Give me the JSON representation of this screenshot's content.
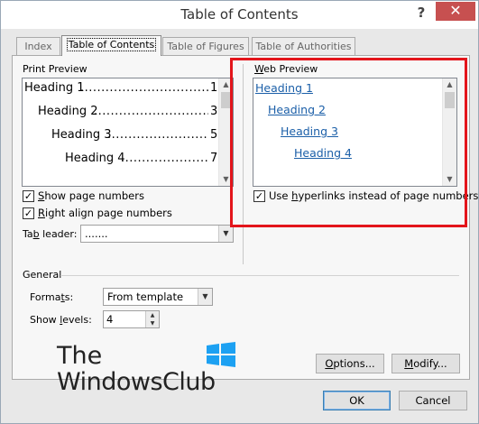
{
  "window": {
    "title": "Table of Contents",
    "help_glyph": "?",
    "close_glyph": "✕"
  },
  "tabs": [
    {
      "label": "Index",
      "active": false
    },
    {
      "label": "Table of Contents",
      "active": true
    },
    {
      "label": "Table of Figures",
      "active": false
    },
    {
      "label": "Table of Authorities",
      "active": false
    }
  ],
  "print_preview": {
    "label": "Print Preview",
    "entries": [
      {
        "text": "Heading 1",
        "dots": "........................................",
        "page": "1"
      },
      {
        "text": "Heading 2",
        "dots": "........................................",
        "page": "3"
      },
      {
        "text": "Heading 3",
        "dots": "........................................",
        "page": "5"
      },
      {
        "text": "Heading 4",
        "dots": "........................................",
        "page": "7"
      }
    ]
  },
  "web_preview": {
    "label_first": "W",
    "label_rest": "eb Preview",
    "links": [
      "Heading 1",
      "Heading 2",
      "Heading 3",
      "Heading 4"
    ]
  },
  "options": {
    "show_page_numbers": {
      "u": "S",
      "rest": "how page numbers",
      "checked": true
    },
    "right_align": {
      "u": "R",
      "rest": "ight align page numbers",
      "checked": true
    },
    "hyperlinks": {
      "pre": "Use ",
      "u": "h",
      "rest": "yperlinks instead of page numbers",
      "checked": true
    },
    "tab_leader": {
      "pre": "Ta",
      "u": "b",
      "rest": " leader:",
      "value": "......."
    }
  },
  "general": {
    "label": "General",
    "formats": {
      "pre": "Forma",
      "u": "t",
      "rest": "s:",
      "value": "From template"
    },
    "show_levels": {
      "pre": "Show ",
      "u": "l",
      "rest": "evels:",
      "value": "4"
    }
  },
  "buttons": {
    "options": {
      "u": "O",
      "rest": "ptions..."
    },
    "modify": {
      "u": "M",
      "rest": "odify..."
    },
    "ok": "OK",
    "cancel": "Cancel"
  },
  "watermark": {
    "line1": "The",
    "line2": "WindowsClub"
  },
  "colors": {
    "link": "#1b5fa8",
    "highlight": "#e3151b",
    "close": "#c75050"
  }
}
